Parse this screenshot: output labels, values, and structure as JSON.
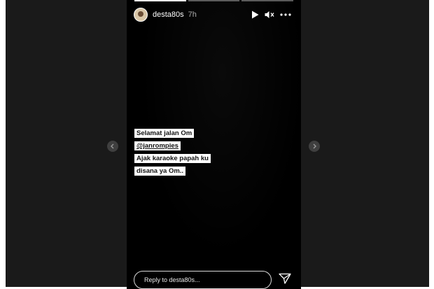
{
  "story": {
    "username": "desta80s",
    "time_ago": "7h",
    "progress": [
      1,
      0,
      0
    ],
    "caption_lines": [
      "Selamat jalan Om",
      "@janrompies",
      "Ajak karaoke papah ku",
      "disana ya Om.."
    ],
    "reply_placeholder": "Reply to desta80s..."
  },
  "icons": {
    "play": "play-icon",
    "mute": "speaker-muted-icon",
    "more": "more-horizontal-icon",
    "send": "send-icon",
    "prev": "chevron-left-icon",
    "next": "chevron-right-icon"
  },
  "colors": {
    "viewer_bg": "#1a1a1a",
    "story_bg": "#000000",
    "text": "#ffffff"
  }
}
